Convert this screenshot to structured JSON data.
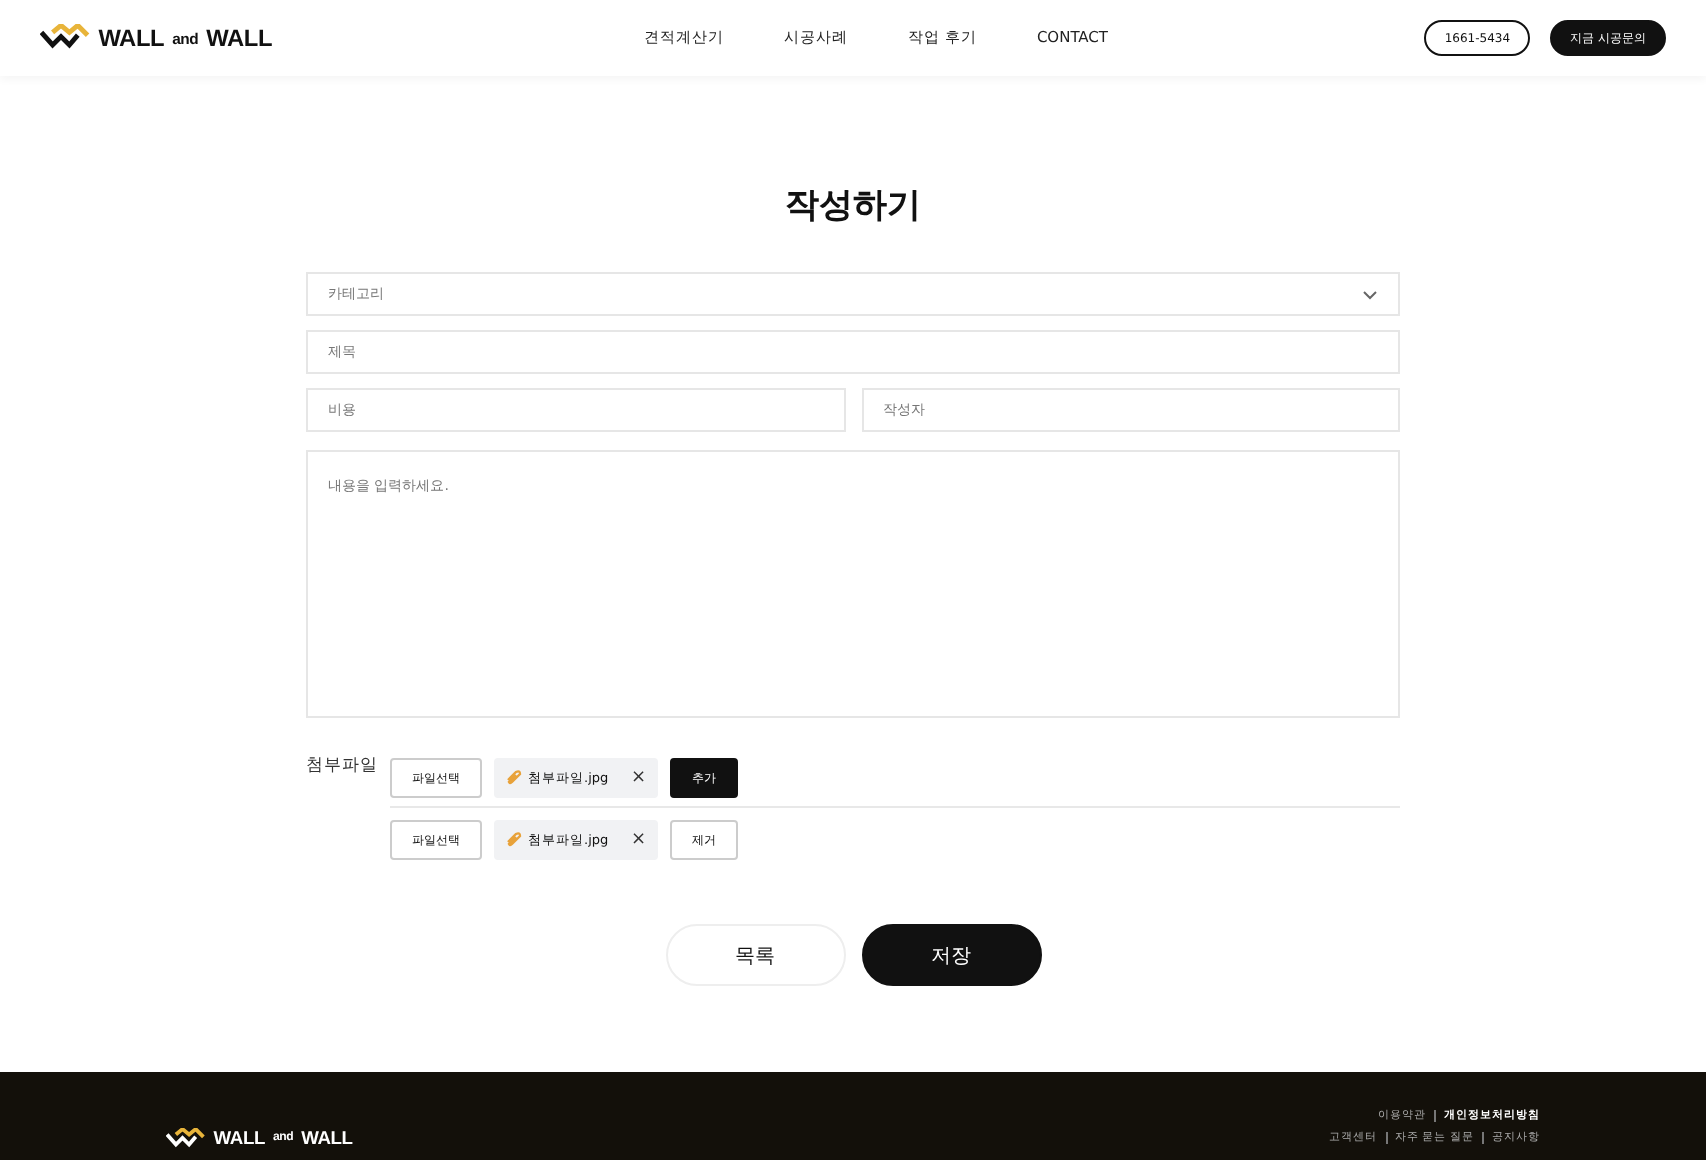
{
  "header": {
    "logo": {
      "word_1": "WALL",
      "word_2": "and",
      "word_3": "WALL"
    },
    "nav": [
      "견적계산기",
      "시공사례",
      "작업 후기",
      "CONTACT"
    ],
    "phone": "1661-5434",
    "cta": "지금 시공문의"
  },
  "title": "작성하기",
  "form": {
    "category": {
      "placeholder": "카테고리"
    },
    "subject": {
      "placeholder": "제목"
    },
    "cost": {
      "placeholder": "비용"
    },
    "author": {
      "placeholder": "작성자"
    },
    "content": {
      "placeholder": "내용을 입력하세요."
    },
    "attachments": {
      "label": "첨부파일",
      "rows": [
        {
          "choose": "파일선택",
          "file": "첨부파일.jpg",
          "remove_icon": "×",
          "action": "추가",
          "kind": "add"
        },
        {
          "choose": "파일선택",
          "file": "첨부파일.jpg",
          "remove_icon": "×",
          "action": "제거",
          "kind": "remove"
        }
      ]
    }
  },
  "buttons": {
    "list": "목록",
    "save": "저장"
  },
  "footer": {
    "logo": {
      "word_1": "WALL",
      "word_2": "and",
      "word_3": "WALL"
    },
    "links_1": [
      {
        "label": "이용약관",
        "bold": false
      },
      {
        "label": "개인정보처리방침",
        "bold": true
      }
    ],
    "links_2": [
      {
        "label": "고객센터",
        "bold": false
      },
      {
        "label": "자주 묻는 질문",
        "bold": false
      },
      {
        "label": "공지사항",
        "bold": false
      }
    ]
  }
}
